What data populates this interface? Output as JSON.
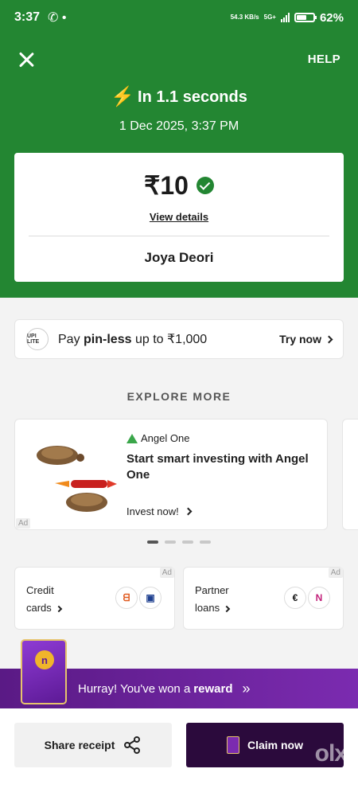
{
  "status_bar": {
    "time": "3:37",
    "network_speed": "54.3 KB/s",
    "network_type": "5G+",
    "battery": "62%",
    "battery_level": 0.62
  },
  "header": {
    "help_label": "HELP",
    "speed_text": "In 1.1 seconds",
    "datetime": "1 Dec 2025, 3:37 PM"
  },
  "payment": {
    "amount": "₹10",
    "view_details_label": "View details",
    "recipient": "Joya  Deori"
  },
  "pinless": {
    "logo_text": "UPI LITE",
    "prefix": "Pay",
    "bold": "pin-less",
    "suffix": "up to ₹1,000",
    "cta": "Try now"
  },
  "explore": {
    "heading": "EXPLORE MORE",
    "ad": {
      "tag": "Ad",
      "brand": "Angel One",
      "title": "Start smart investing with Angel One",
      "cta": "Invest now!"
    },
    "pager_total": 4,
    "pager_active": 0
  },
  "mini_cards": [
    {
      "line1": "Credit",
      "line2": "cards",
      "tag": "Ad"
    },
    {
      "line1": "Partner",
      "line2": "loans",
      "tag": "Ad"
    }
  ],
  "reward": {
    "text": "Hurray! You've won a",
    "bold": "reward",
    "arrows": "»"
  },
  "actions": {
    "share_label": "Share receipt",
    "claim_label": "Claim now"
  },
  "watermark": "olx",
  "colors": {
    "primary_green": "#238632",
    "reward_purple": "#5a1a85",
    "claim_dark": "#2b0a3c"
  }
}
